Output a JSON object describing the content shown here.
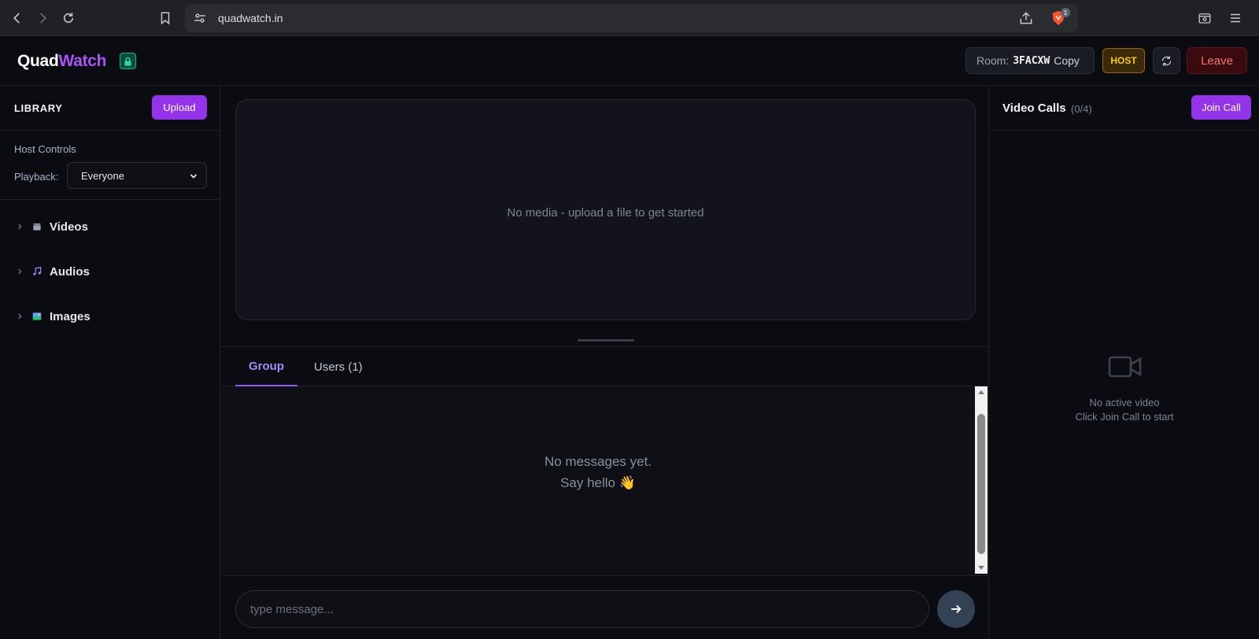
{
  "browser": {
    "url": "quadwatch.in",
    "brave_badge": "1"
  },
  "header": {
    "logo_quad": "Quad",
    "logo_watch": "Watch",
    "room_label": "Room:",
    "room_code": "3FACXW",
    "copy_label": "Copy",
    "host_badge": "HOST",
    "leave_label": "Leave"
  },
  "library": {
    "title": "LIBRARY",
    "upload_label": "Upload",
    "host_controls_title": "Host Controls",
    "playback_label": "Playback:",
    "playback_value": "Everyone",
    "categories": [
      {
        "label": "Videos",
        "icon": "clapper-icon"
      },
      {
        "label": "Audios",
        "icon": "music-note-icon"
      },
      {
        "label": "Images",
        "icon": "picture-icon"
      }
    ]
  },
  "player": {
    "empty_text": "No media - upload a file to get started"
  },
  "chat": {
    "tabs": [
      {
        "label": "Group",
        "active": true
      },
      {
        "label": "Users (1)",
        "active": false
      }
    ],
    "empty_line1": "No messages yet.",
    "empty_line2": "Say hello 👋",
    "input_placeholder": "type message..."
  },
  "video_calls": {
    "title": "Video Calls",
    "count": "(0/4)",
    "join_label": "Join Call",
    "empty_line1": "No active video",
    "empty_line2": "Click Join Call to start"
  },
  "colors": {
    "accent": "#9333ea",
    "brand_watch": "#a855f7",
    "host": "#facc15",
    "leave": "#f87171"
  }
}
